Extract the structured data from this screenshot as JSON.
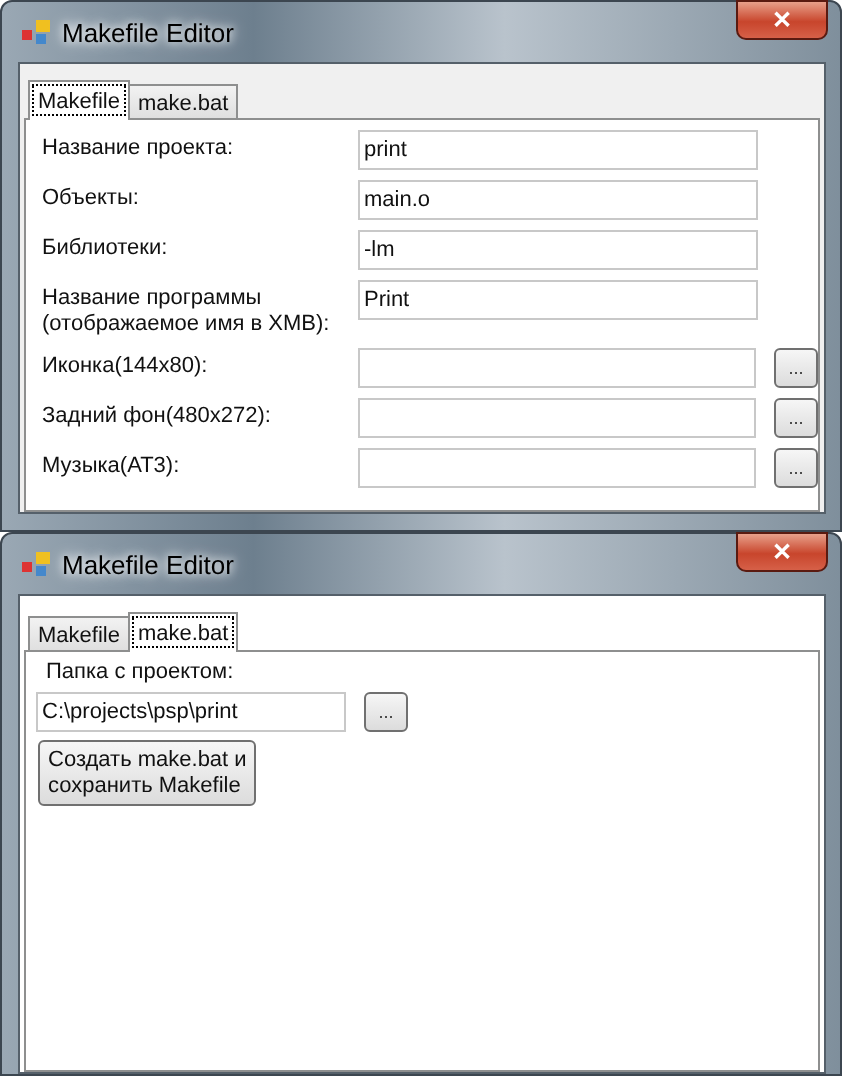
{
  "windows": [
    {
      "title": "Makefile Editor",
      "close": "✕",
      "tabs": [
        {
          "label": "Makefile",
          "selected": true
        },
        {
          "label": "make.bat",
          "selected": false
        }
      ],
      "panel": {
        "kind": "makefile",
        "rows": [
          {
            "label": "Название проекта:",
            "value": "print"
          },
          {
            "label": "Объекты:",
            "value": "main.o"
          },
          {
            "label": "Библиотеки:",
            "value": "-lm"
          },
          {
            "label": "Название программы\n(отображаемое имя в XMB):",
            "value": "Print"
          },
          {
            "label": "Иконка(144x80):",
            "browse": "..."
          },
          {
            "label": "Задний фон(480x272):",
            "browse": "..."
          },
          {
            "label": "Музыка(AT3):",
            "browse": "..."
          }
        ]
      }
    },
    {
      "title": "Makefile Editor",
      "close": "✕",
      "tabs": [
        {
          "label": "Makefile",
          "selected": false
        },
        {
          "label": "make.bat",
          "selected": true
        }
      ],
      "panel": {
        "kind": "makebat",
        "folder_label": "Папка с проектом:",
        "folder": "C:\\projects\\psp\\print",
        "browse": "...",
        "create_button": "Создать make.bat и\nсохранить Makefile"
      }
    }
  ]
}
